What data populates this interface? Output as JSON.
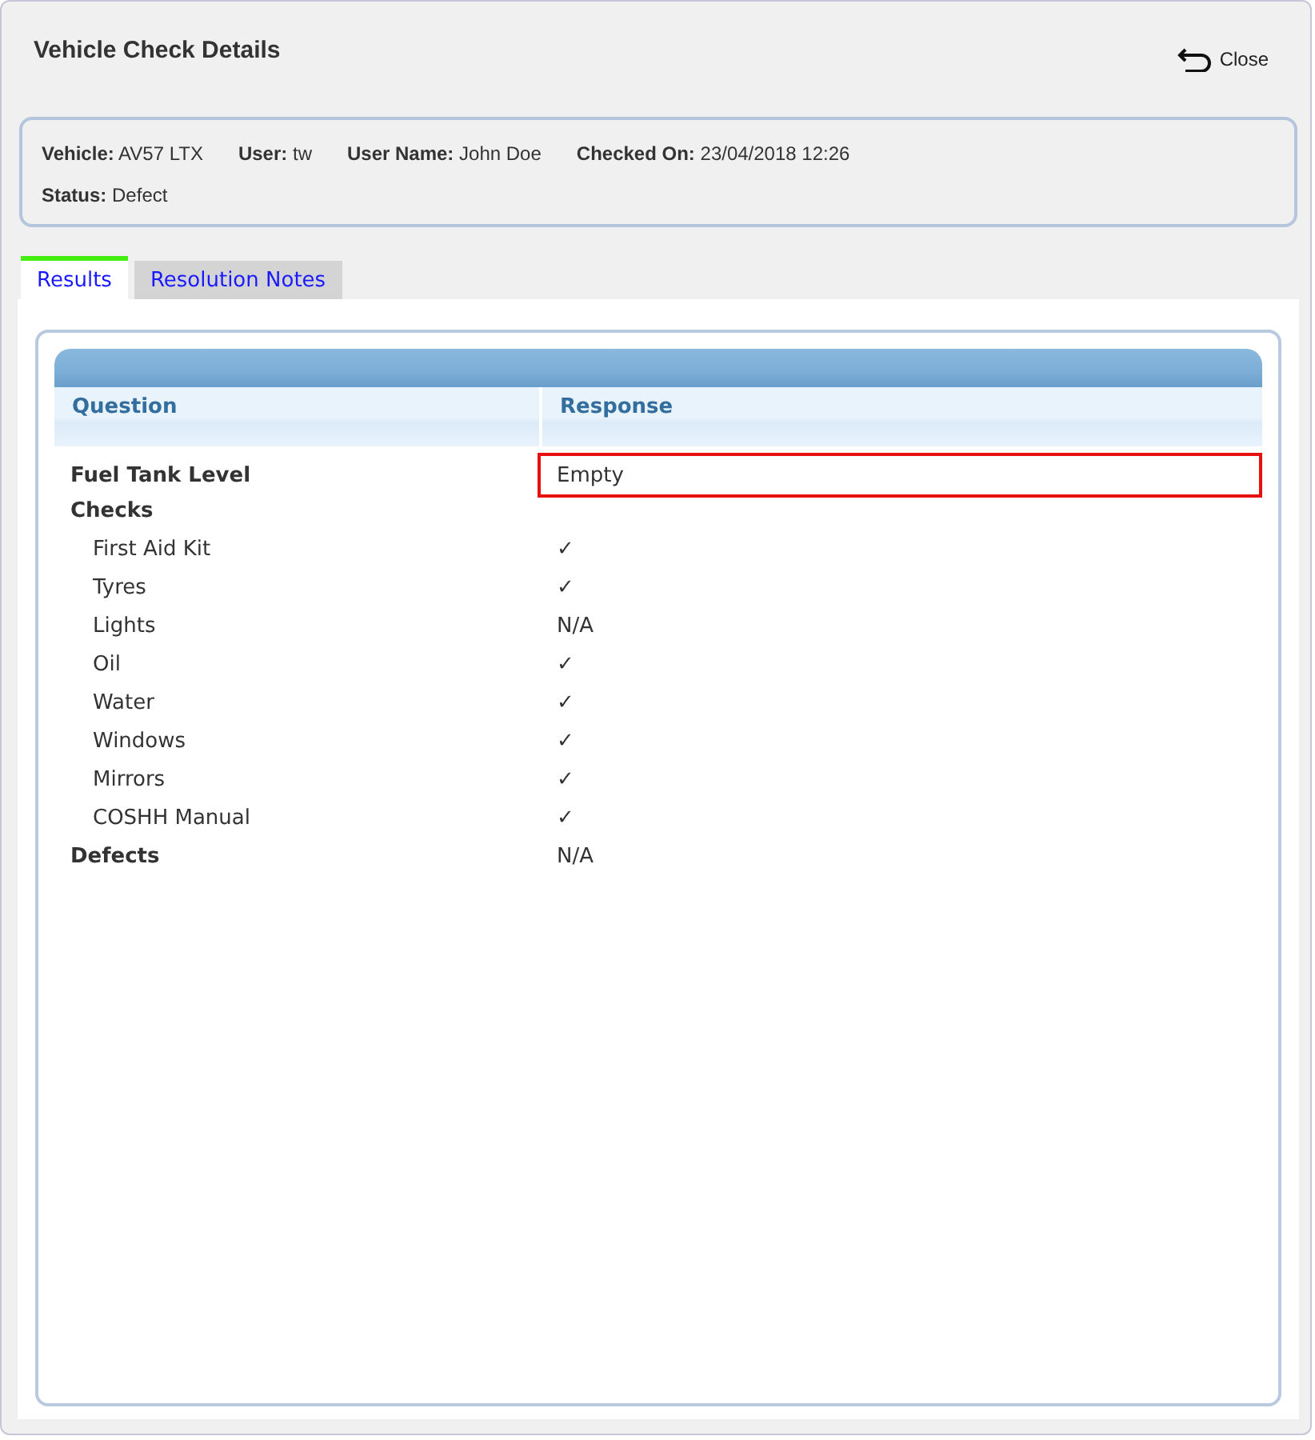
{
  "dialog": {
    "title": "Vehicle Check Details",
    "close_label": "Close"
  },
  "info": [
    {
      "label": "Vehicle:",
      "value": "AV57 LTX"
    },
    {
      "label": "User:",
      "value": "tw"
    },
    {
      "label": "User Name:",
      "value": "John Doe"
    },
    {
      "label": "Checked On:",
      "value": "23/04/2018 12:26"
    },
    {
      "label": "Status:",
      "value": "Defect"
    }
  ],
  "tabs": [
    {
      "label": "Results",
      "selected": true
    },
    {
      "label": "Resolution Notes",
      "selected": false
    }
  ],
  "table": {
    "columns": [
      "Question",
      "Response"
    ],
    "rows": [
      {
        "question": "Fuel Tank Level",
        "response": "Empty",
        "flagged": true
      },
      {
        "question": "Checks",
        "children": [
          {
            "question": "First Aid Kit",
            "response": "✓",
            "flagged": false
          },
          {
            "question": "Tyres",
            "response": "✓",
            "flagged": false
          },
          {
            "question": "Lights",
            "response": "N/A",
            "flagged": false
          },
          {
            "question": "Oil",
            "response": "✓",
            "flagged": false
          },
          {
            "question": "Water",
            "response": "✓",
            "flagged": false
          },
          {
            "question": "Windows",
            "response": "✓",
            "flagged": false
          },
          {
            "question": "Mirrors",
            "response": "✓",
            "flagged": false
          },
          {
            "question": "COSHH Manual",
            "response": "✓",
            "flagged": false
          }
        ]
      },
      {
        "question": "Defects",
        "response": "N/A",
        "flagged": false
      }
    ]
  }
}
